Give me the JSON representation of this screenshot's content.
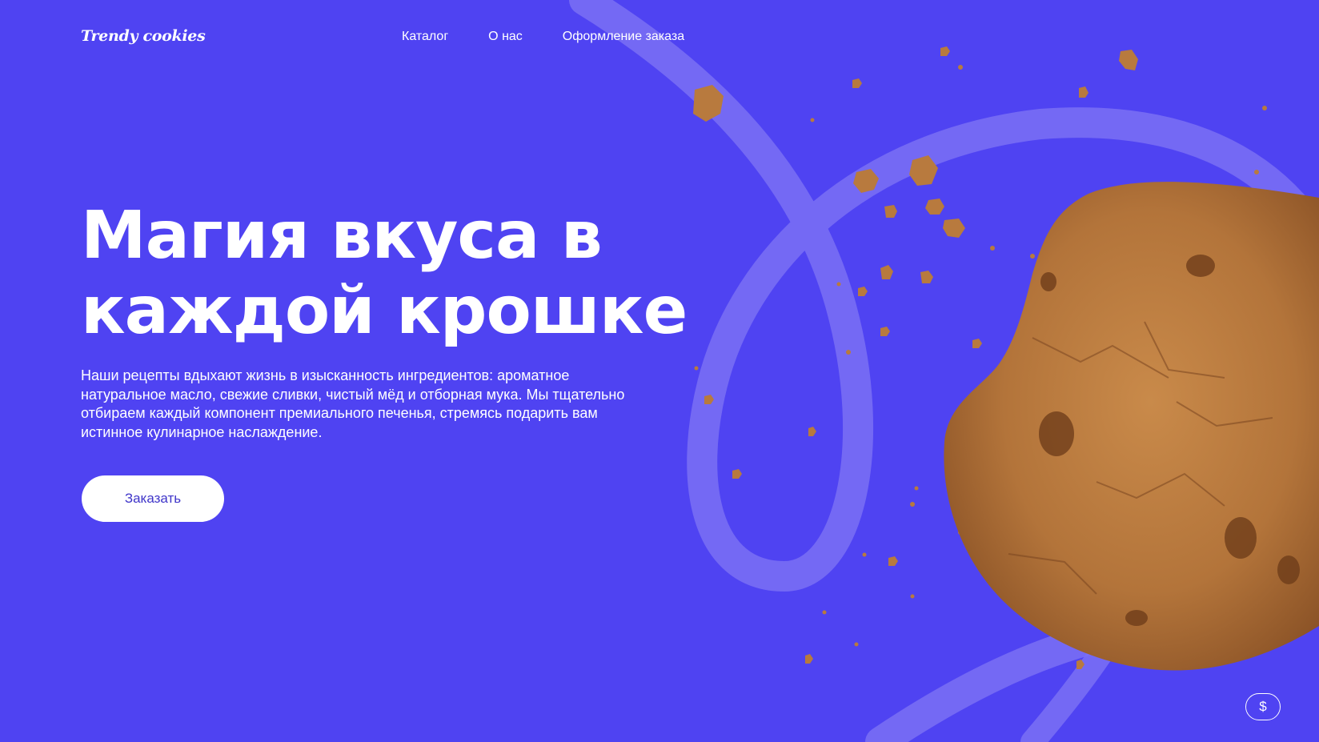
{
  "header": {
    "logo": "Trendy cookies",
    "nav": [
      "Каталог",
      "О нас",
      "Оформление заказа"
    ]
  },
  "hero": {
    "title_line1": "Магия вкуса в",
    "title_line2": "каждой крошке",
    "text": "Наши рецепты вдыхают жизнь в изысканность ингредиентов: ароматное натуральное масло, свежие сливки, чистый мёд и отборная мука. Мы тщательно отбираем каждый компонент премиального печенья, стремясь подарить вам истинное кулинарное наслаждение.",
    "order_button": "Заказать"
  },
  "currency_button": "$",
  "colors": {
    "background": "#4f43f2",
    "ribbon": "#7a70f5",
    "button_text": "#3f35c9",
    "cookie": "#b5743a"
  },
  "images": {
    "hero": "cookie-with-crumbs"
  }
}
